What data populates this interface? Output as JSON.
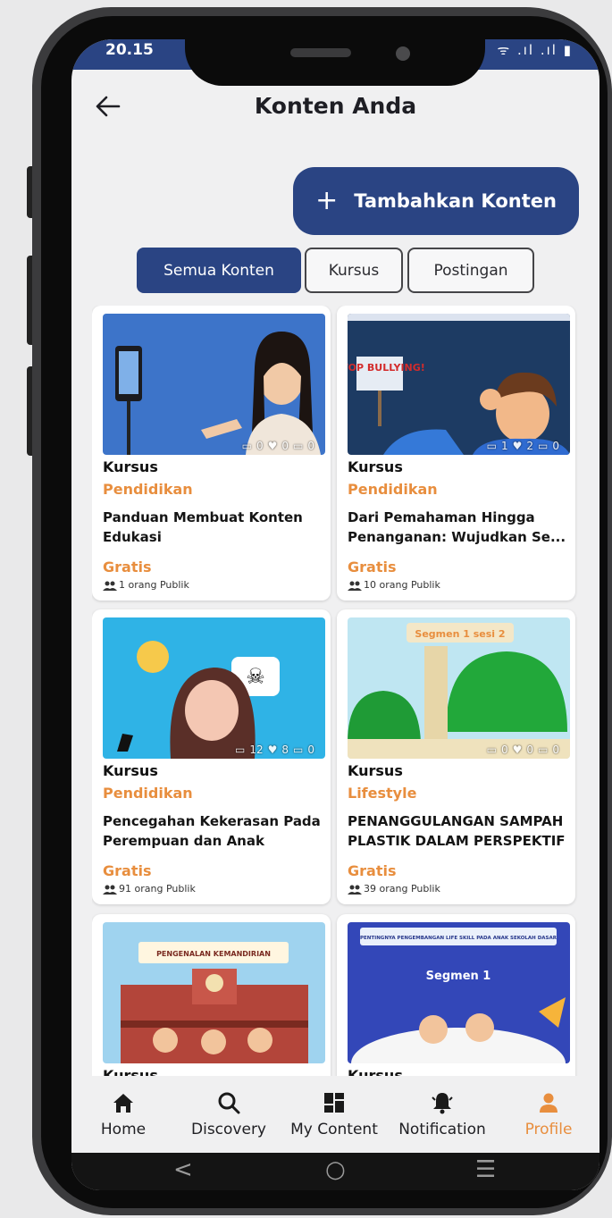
{
  "status_bar": {
    "time": "20.15",
    "signal": "ᯤ .ıl .ıl ▮"
  },
  "header": {
    "title": "Konten Anda"
  },
  "add_button": {
    "label": "Tambahkan Konten"
  },
  "tabs": [
    {
      "label": "Semua Konten",
      "active": true
    },
    {
      "label": "Kursus",
      "active": false
    },
    {
      "label": "Postingan",
      "active": false
    }
  ],
  "cards": [
    {
      "type": "Kursus",
      "category": "Pendidikan",
      "title": "Panduan Membuat Konten Edukasi",
      "price": "Gratis",
      "members": "1 orang Publik",
      "stats": {
        "comments": "0",
        "likes": "0",
        "views": "0"
      }
    },
    {
      "type": "Kursus",
      "category": "Pendidikan",
      "title": "Dari Pemahaman Hingga Penanganan: Wujudkan Se...",
      "price": "Gratis",
      "members": "10 orang Publik",
      "thumb_text": "STOP BULLYING!",
      "stats": {
        "comments": "1",
        "likes": "2",
        "views": "0"
      }
    },
    {
      "type": "Kursus",
      "category": "Pendidikan",
      "title": "Pencegahan Kekerasan Pada Perempuan dan Anak",
      "price": "Gratis",
      "members": "91 orang Publik",
      "stats": {
        "comments": "12",
        "likes": "8",
        "views": "0"
      }
    },
    {
      "type": "Kursus",
      "category": "Lifestyle",
      "title": "PENANGGULANGAN SAMPAH PLASTIK DALAM PERSPEKTIF I...",
      "price": "Gratis",
      "members": "39 orang Publik",
      "thumb_text": "Segmen 1 sesi 2",
      "stats": {
        "comments": "0",
        "likes": "0",
        "views": "0"
      }
    },
    {
      "type": "Kursus",
      "category": "",
      "title": "",
      "price": "",
      "members": "",
      "thumb_text": "PENGENALAN KEMANDIRIAN"
    },
    {
      "type": "Kursus",
      "category": "",
      "title": "",
      "price": "",
      "members": "",
      "thumb_text": "PENTINGNYA PENGEMBANGAN LIFE SKILL PADA ANAK SEKOLAH DASAR",
      "thumb_text2": "Segmen 1"
    }
  ],
  "bottom_nav": [
    {
      "label": "Home",
      "icon": "home-icon",
      "active": false
    },
    {
      "label": "Discovery",
      "icon": "search-icon",
      "active": false
    },
    {
      "label": "My Content",
      "icon": "grid-icon",
      "active": false
    },
    {
      "label": "Notification",
      "icon": "bell-icon",
      "active": false
    },
    {
      "label": "Profile",
      "icon": "person-icon",
      "active": true
    }
  ],
  "system_nav": {
    "back": "<",
    "home": "○",
    "recents": "☰"
  },
  "colors": {
    "primary": "#2a4483",
    "accent": "#e88e3e",
    "background": "#f0f0f1"
  }
}
